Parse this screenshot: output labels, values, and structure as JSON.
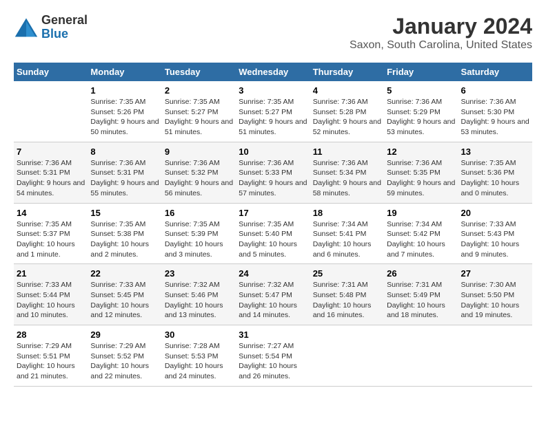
{
  "logo": {
    "general": "General",
    "blue": "Blue"
  },
  "title": "January 2024",
  "subtitle": "Saxon, South Carolina, United States",
  "days_of_week": [
    "Sunday",
    "Monday",
    "Tuesday",
    "Wednesday",
    "Thursday",
    "Friday",
    "Saturday"
  ],
  "weeks": [
    [
      {
        "num": "",
        "sunrise": "",
        "sunset": "",
        "daylight": ""
      },
      {
        "num": "1",
        "sunrise": "Sunrise: 7:35 AM",
        "sunset": "Sunset: 5:26 PM",
        "daylight": "Daylight: 9 hours and 50 minutes."
      },
      {
        "num": "2",
        "sunrise": "Sunrise: 7:35 AM",
        "sunset": "Sunset: 5:27 PM",
        "daylight": "Daylight: 9 hours and 51 minutes."
      },
      {
        "num": "3",
        "sunrise": "Sunrise: 7:35 AM",
        "sunset": "Sunset: 5:27 PM",
        "daylight": "Daylight: 9 hours and 51 minutes."
      },
      {
        "num": "4",
        "sunrise": "Sunrise: 7:36 AM",
        "sunset": "Sunset: 5:28 PM",
        "daylight": "Daylight: 9 hours and 52 minutes."
      },
      {
        "num": "5",
        "sunrise": "Sunrise: 7:36 AM",
        "sunset": "Sunset: 5:29 PM",
        "daylight": "Daylight: 9 hours and 53 minutes."
      },
      {
        "num": "6",
        "sunrise": "Sunrise: 7:36 AM",
        "sunset": "Sunset: 5:30 PM",
        "daylight": "Daylight: 9 hours and 53 minutes."
      }
    ],
    [
      {
        "num": "7",
        "sunrise": "Sunrise: 7:36 AM",
        "sunset": "Sunset: 5:31 PM",
        "daylight": "Daylight: 9 hours and 54 minutes."
      },
      {
        "num": "8",
        "sunrise": "Sunrise: 7:36 AM",
        "sunset": "Sunset: 5:31 PM",
        "daylight": "Daylight: 9 hours and 55 minutes."
      },
      {
        "num": "9",
        "sunrise": "Sunrise: 7:36 AM",
        "sunset": "Sunset: 5:32 PM",
        "daylight": "Daylight: 9 hours and 56 minutes."
      },
      {
        "num": "10",
        "sunrise": "Sunrise: 7:36 AM",
        "sunset": "Sunset: 5:33 PM",
        "daylight": "Daylight: 9 hours and 57 minutes."
      },
      {
        "num": "11",
        "sunrise": "Sunrise: 7:36 AM",
        "sunset": "Sunset: 5:34 PM",
        "daylight": "Daylight: 9 hours and 58 minutes."
      },
      {
        "num": "12",
        "sunrise": "Sunrise: 7:36 AM",
        "sunset": "Sunset: 5:35 PM",
        "daylight": "Daylight: 9 hours and 59 minutes."
      },
      {
        "num": "13",
        "sunrise": "Sunrise: 7:35 AM",
        "sunset": "Sunset: 5:36 PM",
        "daylight": "Daylight: 10 hours and 0 minutes."
      }
    ],
    [
      {
        "num": "14",
        "sunrise": "Sunrise: 7:35 AM",
        "sunset": "Sunset: 5:37 PM",
        "daylight": "Daylight: 10 hours and 1 minute."
      },
      {
        "num": "15",
        "sunrise": "Sunrise: 7:35 AM",
        "sunset": "Sunset: 5:38 PM",
        "daylight": "Daylight: 10 hours and 2 minutes."
      },
      {
        "num": "16",
        "sunrise": "Sunrise: 7:35 AM",
        "sunset": "Sunset: 5:39 PM",
        "daylight": "Daylight: 10 hours and 3 minutes."
      },
      {
        "num": "17",
        "sunrise": "Sunrise: 7:35 AM",
        "sunset": "Sunset: 5:40 PM",
        "daylight": "Daylight: 10 hours and 5 minutes."
      },
      {
        "num": "18",
        "sunrise": "Sunrise: 7:34 AM",
        "sunset": "Sunset: 5:41 PM",
        "daylight": "Daylight: 10 hours and 6 minutes."
      },
      {
        "num": "19",
        "sunrise": "Sunrise: 7:34 AM",
        "sunset": "Sunset: 5:42 PM",
        "daylight": "Daylight: 10 hours and 7 minutes."
      },
      {
        "num": "20",
        "sunrise": "Sunrise: 7:33 AM",
        "sunset": "Sunset: 5:43 PM",
        "daylight": "Daylight: 10 hours and 9 minutes."
      }
    ],
    [
      {
        "num": "21",
        "sunrise": "Sunrise: 7:33 AM",
        "sunset": "Sunset: 5:44 PM",
        "daylight": "Daylight: 10 hours and 10 minutes."
      },
      {
        "num": "22",
        "sunrise": "Sunrise: 7:33 AM",
        "sunset": "Sunset: 5:45 PM",
        "daylight": "Daylight: 10 hours and 12 minutes."
      },
      {
        "num": "23",
        "sunrise": "Sunrise: 7:32 AM",
        "sunset": "Sunset: 5:46 PM",
        "daylight": "Daylight: 10 hours and 13 minutes."
      },
      {
        "num": "24",
        "sunrise": "Sunrise: 7:32 AM",
        "sunset": "Sunset: 5:47 PM",
        "daylight": "Daylight: 10 hours and 14 minutes."
      },
      {
        "num": "25",
        "sunrise": "Sunrise: 7:31 AM",
        "sunset": "Sunset: 5:48 PM",
        "daylight": "Daylight: 10 hours and 16 minutes."
      },
      {
        "num": "26",
        "sunrise": "Sunrise: 7:31 AM",
        "sunset": "Sunset: 5:49 PM",
        "daylight": "Daylight: 10 hours and 18 minutes."
      },
      {
        "num": "27",
        "sunrise": "Sunrise: 7:30 AM",
        "sunset": "Sunset: 5:50 PM",
        "daylight": "Daylight: 10 hours and 19 minutes."
      }
    ],
    [
      {
        "num": "28",
        "sunrise": "Sunrise: 7:29 AM",
        "sunset": "Sunset: 5:51 PM",
        "daylight": "Daylight: 10 hours and 21 minutes."
      },
      {
        "num": "29",
        "sunrise": "Sunrise: 7:29 AM",
        "sunset": "Sunset: 5:52 PM",
        "daylight": "Daylight: 10 hours and 22 minutes."
      },
      {
        "num": "30",
        "sunrise": "Sunrise: 7:28 AM",
        "sunset": "Sunset: 5:53 PM",
        "daylight": "Daylight: 10 hours and 24 minutes."
      },
      {
        "num": "31",
        "sunrise": "Sunrise: 7:27 AM",
        "sunset": "Sunset: 5:54 PM",
        "daylight": "Daylight: 10 hours and 26 minutes."
      },
      {
        "num": "",
        "sunrise": "",
        "sunset": "",
        "daylight": ""
      },
      {
        "num": "",
        "sunrise": "",
        "sunset": "",
        "daylight": ""
      },
      {
        "num": "",
        "sunrise": "",
        "sunset": "",
        "daylight": ""
      }
    ]
  ]
}
